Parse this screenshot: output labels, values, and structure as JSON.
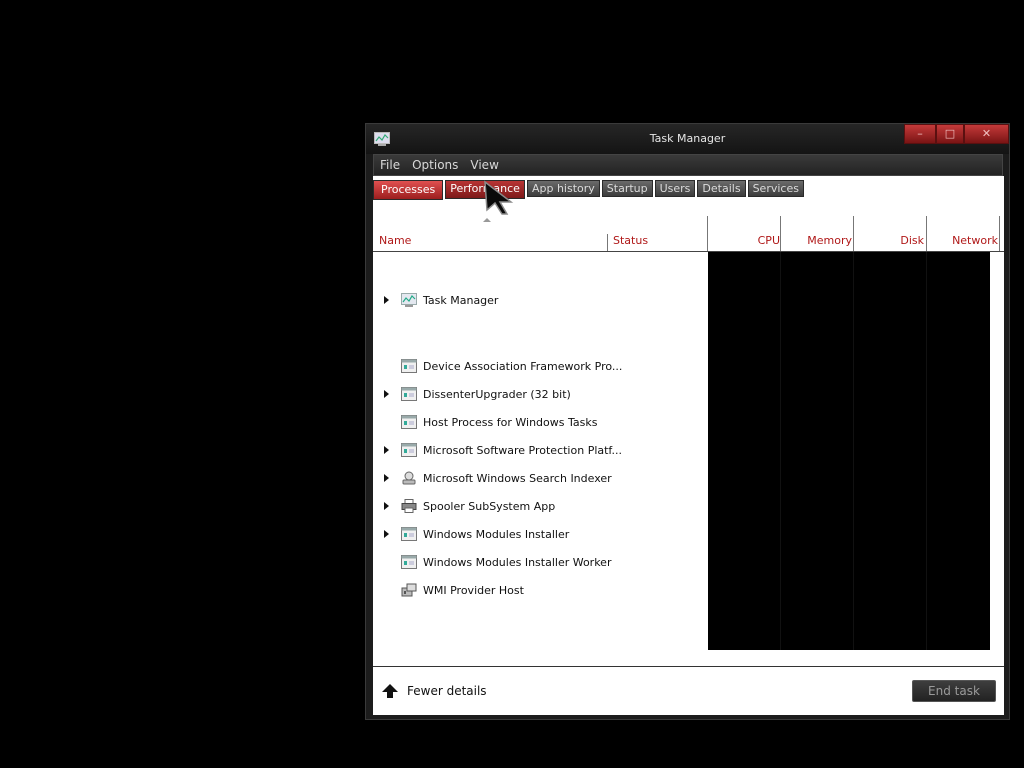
{
  "window": {
    "title": "Task Manager",
    "controls": {
      "minimize": "–",
      "maximize": "□",
      "close": "✕"
    }
  },
  "menubar": {
    "items": [
      "File",
      "Options",
      "View"
    ]
  },
  "tabs": [
    "Processes",
    "Performance",
    "App history",
    "Startup",
    "Users",
    "Details",
    "Services"
  ],
  "active_tab": "Processes",
  "columns": {
    "name": "Name",
    "status": "Status",
    "cpu": "CPU",
    "memory": "Memory",
    "disk": "Disk",
    "network": "Network"
  },
  "processes": [
    {
      "name": "Task Manager",
      "icon": "task-manager-icon",
      "expandable": true
    },
    {
      "name": "Device Association Framework Pro...",
      "icon": "service-window-icon",
      "expandable": false
    },
    {
      "name": "DissenterUpgrader (32 bit)",
      "icon": "service-window-icon",
      "expandable": true
    },
    {
      "name": "Host Process for Windows Tasks",
      "icon": "service-window-icon",
      "expandable": false
    },
    {
      "name": "Microsoft Software Protection Platf...",
      "icon": "service-window-icon",
      "expandable": true
    },
    {
      "name": "Microsoft Windows Search Indexer",
      "icon": "search-indexer-icon",
      "expandable": true
    },
    {
      "name": "Spooler SubSystem App",
      "icon": "printer-icon",
      "expandable": true
    },
    {
      "name": "Windows Modules Installer",
      "icon": "service-window-icon",
      "expandable": true
    },
    {
      "name": "Windows Modules Installer Worker",
      "icon": "service-window-icon",
      "expandable": false
    },
    {
      "name": "WMI Provider Host",
      "icon": "wmi-icon",
      "expandable": false
    }
  ],
  "footer": {
    "fewer_details": "Fewer details",
    "end_task": "End task"
  },
  "colors": {
    "accent_red": "#b01818",
    "tab_active": "#d04040",
    "background": "#000000"
  }
}
